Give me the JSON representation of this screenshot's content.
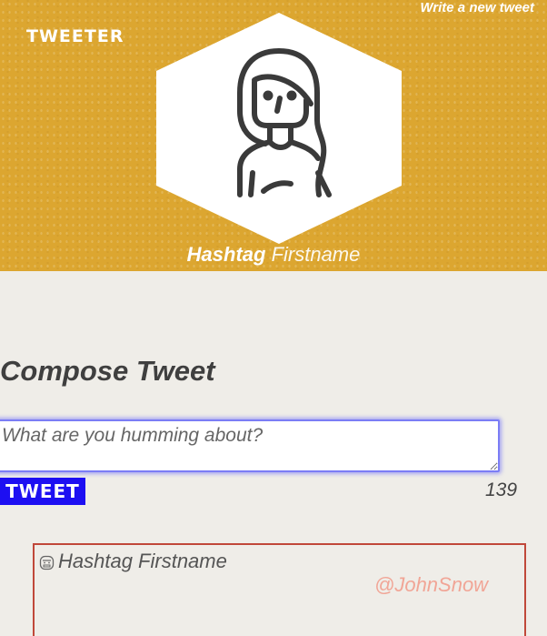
{
  "header": {
    "logo": "TWEETER",
    "write_link": "Write a new tweet",
    "profile": {
      "first_name": "Hashtag",
      "last_name": "Firstname",
      "avatar_icon": "female-user-avatar-icon"
    }
  },
  "compose": {
    "title": "Compose Tweet",
    "placeholder": "What are you humming about?",
    "input_value": "",
    "button_label": "TWEET",
    "char_count": "139"
  },
  "tweets": [
    {
      "avatar_icon": "small-face-icon",
      "name": "Hashtag Firstname",
      "handle": "@JohnSnow"
    }
  ],
  "colors": {
    "header_bg": "#dca630",
    "page_bg": "#efede8",
    "tweet_button_bg": "#1d0ff2",
    "card_border": "#c0483a",
    "handle": "#f1a596",
    "input_focus": "#7b7df5"
  }
}
